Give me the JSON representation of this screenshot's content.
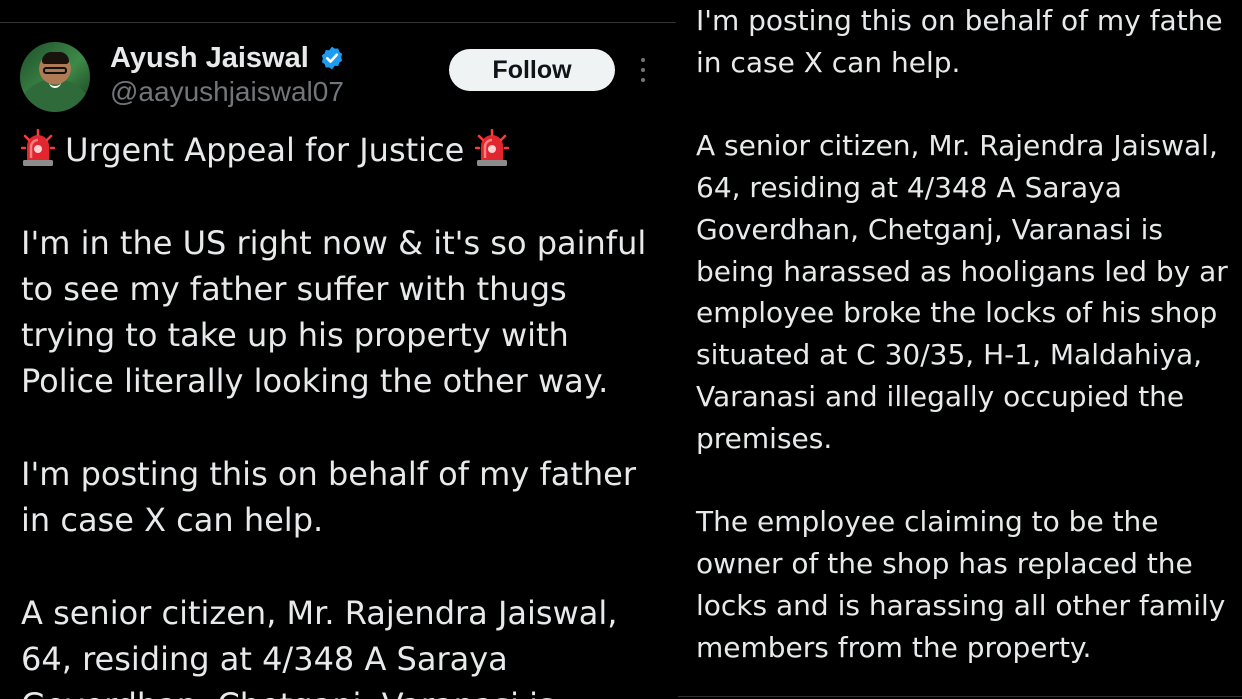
{
  "author": {
    "name": "Ayush Jaiswal",
    "handle": "@aayushjaiswal07",
    "verified_badge_icon": "verified-badge-icon",
    "badge_color": "#1d9bf0"
  },
  "actions": {
    "follow_label": "Follow",
    "more_icon": "more-options-icon"
  },
  "tweet": {
    "title": "Urgent Appeal for Justice",
    "title_icon": "police-car-light-emoji",
    "paragraph1": [
      "I'm in the US right now & it's so painful",
      "to see my father suffer with thugs",
      "trying to take up his property with",
      "Police literally looking the other way."
    ],
    "paragraph2": [
      "I'm posting this on behalf of my father",
      "in case X can help."
    ],
    "paragraph3_visible": [
      "A senior citizen, Mr. Rajendra Jaiswal,",
      "64, residing at 4/348 A Saraya",
      "Goverdhan, Chetganj, Varanasi is"
    ]
  },
  "continuation": {
    "paragraph1": [
      "I'm posting this on behalf of my fathe",
      "in case X can help."
    ],
    "paragraph2": [
      "A senior citizen, Mr. Rajendra Jaiswal,",
      "64, residing at 4/348 A Saraya",
      "Goverdhan, Chetganj, Varanasi is",
      "being harassed as hooligans led by ar",
      "employee broke the locks of his shop",
      "situated at C 30/35, H-1, Maldahiya,",
      "Varanasi and illegally occupied the",
      "premises."
    ],
    "paragraph3": [
      "The employee claiming to be the",
      "owner of the shop has replaced the",
      "locks and is harassing all other family",
      "members from the property."
    ]
  },
  "colors": {
    "background": "#000000",
    "text": "#e7e9ea",
    "secondary_text": "#71767b",
    "follow_bg": "#eff3f4",
    "divider": "#2f3336"
  }
}
